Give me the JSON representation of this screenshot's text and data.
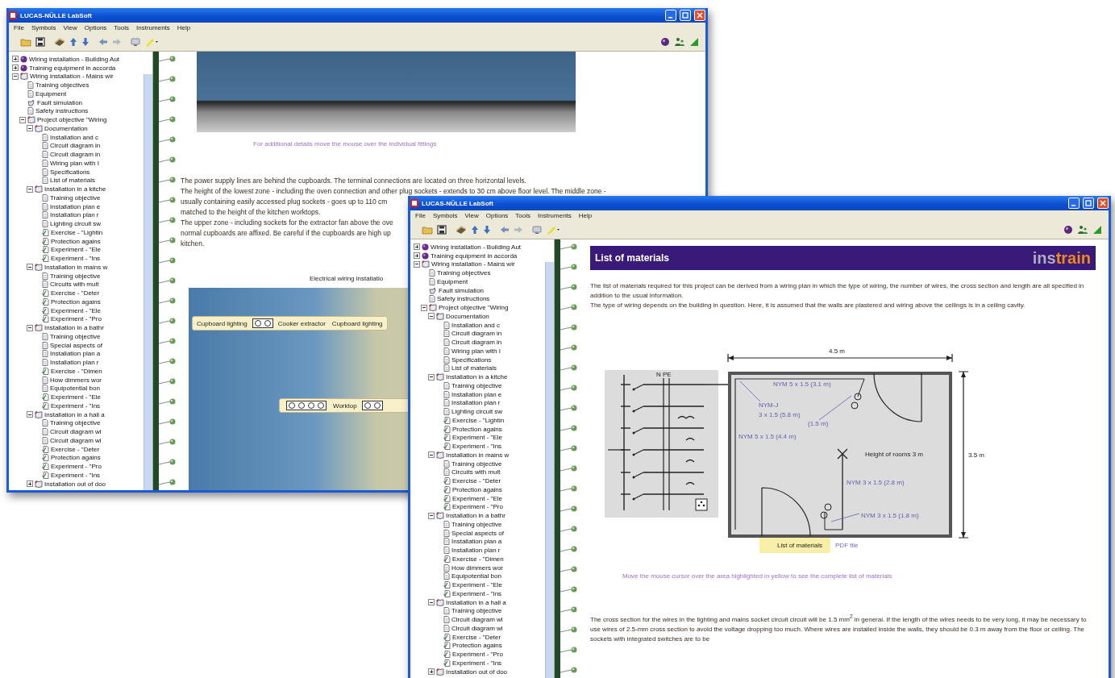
{
  "windows": [
    {
      "title": "LUCAS-NÜLLE LabSoft",
      "menu": [
        "File",
        "Symbols",
        "View",
        "Options",
        "Tools",
        "Instruments",
        "Help"
      ],
      "tree": [
        {
          "label": "Wiring installation - Building Aut",
          "kind": "module",
          "expanded": false
        },
        {
          "label": "Training equipment in accorda",
          "kind": "module",
          "expanded": false
        },
        {
          "label": "Wiring installation - Mains wir",
          "kind": "chapter",
          "expanded": true,
          "children": [
            {
              "label": "Training objectives",
              "kind": "page"
            },
            {
              "label": "Equipment",
              "kind": "page"
            },
            {
              "label": "Fault simulation",
              "kind": "tool"
            },
            {
              "label": "Safety instructions",
              "kind": "page"
            },
            {
              "label": "Project objective \"Wiring",
              "kind": "chapter",
              "expanded": true,
              "children": [
                {
                  "label": "Documentation",
                  "kind": "chapter",
                  "expanded": true,
                  "children": [
                    {
                      "label": "Installation and c",
                      "kind": "page"
                    },
                    {
                      "label": "Circuit diagram in",
                      "kind": "page"
                    },
                    {
                      "label": "Circuit diagram in",
                      "kind": "page"
                    },
                    {
                      "label": "Wiring plan with I",
                      "kind": "page"
                    },
                    {
                      "label": "Specifications",
                      "kind": "page"
                    },
                    {
                      "label": "List of materials",
                      "kind": "page"
                    }
                  ]
                },
                {
                  "label": "Installation in a kitche",
                  "kind": "chapter",
                  "expanded": true,
                  "children": [
                    {
                      "label": "Training objective",
                      "kind": "page"
                    },
                    {
                      "label": "Installation plan e",
                      "kind": "page"
                    },
                    {
                      "label": "Installation plan r",
                      "kind": "page"
                    },
                    {
                      "label": "Lighting circuit sw",
                      "kind": "page"
                    },
                    {
                      "label": "Exercise - \"Lightin",
                      "kind": "task"
                    },
                    {
                      "label": "Protection agains",
                      "kind": "task"
                    },
                    {
                      "label": "Experiment - \"Ele",
                      "kind": "task"
                    },
                    {
                      "label": "Experiment - \"Ins",
                      "kind": "task"
                    }
                  ]
                },
                {
                  "label": "Installation in mains w",
                  "kind": "chapter",
                  "expanded": true,
                  "children": [
                    {
                      "label": "Training objective",
                      "kind": "page"
                    },
                    {
                      "label": "Circuits with mult",
                      "kind": "page"
                    },
                    {
                      "label": "Exercise - \"Deter",
                      "kind": "task"
                    },
                    {
                      "label": "Protection agains",
                      "kind": "task"
                    },
                    {
                      "label": "Experiment - \"Ele",
                      "kind": "task"
                    },
                    {
                      "label": "Experiment - \"Pro",
                      "kind": "task"
                    }
                  ]
                },
                {
                  "label": "Installation in a bathr",
                  "kind": "chapter",
                  "expanded": true,
                  "children": [
                    {
                      "label": "Training objective",
                      "kind": "page"
                    },
                    {
                      "label": "Special aspects of",
                      "kind": "page"
                    },
                    {
                      "label": "Installation plan a",
                      "kind": "page"
                    },
                    {
                      "label": "Installation plan r",
                      "kind": "page"
                    },
                    {
                      "label": "Exercise - \"Dimen",
                      "kind": "task"
                    },
                    {
                      "label": "How dimmers wor",
                      "kind": "page"
                    },
                    {
                      "label": "Equipotential bon",
                      "kind": "page"
                    },
                    {
                      "label": "Experiment - \"Ele",
                      "kind": "task"
                    },
                    {
                      "label": "Experiment - \"Ins",
                      "kind": "task"
                    }
                  ]
                },
                {
                  "label": "Installation in a hall a",
                  "kind": "chapter",
                  "expanded": true,
                  "children": [
                    {
                      "label": "Training objective",
                      "kind": "page"
                    },
                    {
                      "label": "Circuit diagram wi",
                      "kind": "page"
                    },
                    {
                      "label": "Circuit diagram wi",
                      "kind": "page"
                    },
                    {
                      "label": "Exercise - \"Deter",
                      "kind": "task"
                    },
                    {
                      "label": "Protection agains",
                      "kind": "task"
                    },
                    {
                      "label": "Experiment - \"Pro",
                      "kind": "task"
                    },
                    {
                      "label": "Experiment - \"Ins",
                      "kind": "task"
                    }
                  ]
                },
                {
                  "label": "Installation out of doo",
                  "kind": "chapter",
                  "expanded": false
                }
              ]
            }
          ]
        }
      ],
      "content": {
        "kind": "kitchen",
        "caption": "For additional details move the mouse over the individual fittings",
        "lines": [
          "The power supply lines are behind the cupboards. The terminal connections are located on three horizontal levels.",
          "The height of the lowest zone - including the oven connection and other plug sockets - extends to 30 cm above floor level. The middle zone -",
          "usually containing easily accessed plug sockets - goes up to 110 cm",
          "matched to the height of the kitchen worktops.",
          "The upper zone - including sockets for the extractor fan above the ove",
          "normal cupboards are affixed. Be careful if the cupboards are high up",
          "kitchen."
        ],
        "heading": "Electrical wiring installatio",
        "hotspots_top": [
          "Cupboard lighting",
          "Cooker extractor",
          "Cupboard lighting"
        ],
        "hotspot_worktop": "Worktop"
      }
    },
    {
      "title": "LUCAS-NÜLLE LabSoft",
      "menu": [
        "File",
        "Symbols",
        "View",
        "Options",
        "Tools",
        "Instruments",
        "Help"
      ],
      "tree": [
        {
          "label": "Wiring installation - Building Aut",
          "kind": "module",
          "expanded": false
        },
        {
          "label": "Training equipment in accorda",
          "kind": "module",
          "expanded": false
        },
        {
          "label": "Wiring installation - Mains wir",
          "kind": "chapter",
          "expanded": true,
          "children": [
            {
              "label": "Training objectives",
              "kind": "page"
            },
            {
              "label": "Equipment",
              "kind": "page"
            },
            {
              "label": "Fault simulation",
              "kind": "tool"
            },
            {
              "label": "Safety instructions",
              "kind": "page"
            },
            {
              "label": "Project objective \"Wiring",
              "kind": "chapter",
              "expanded": true,
              "children": [
                {
                  "label": "Documentation",
                  "kind": "chapter",
                  "expanded": true,
                  "children": [
                    {
                      "label": "Installation and c",
                      "kind": "page"
                    },
                    {
                      "label": "Circuit diagram in",
                      "kind": "page"
                    },
                    {
                      "label": "Circuit diagram in",
                      "kind": "page"
                    },
                    {
                      "label": "Wiring plan with I",
                      "kind": "page"
                    },
                    {
                      "label": "Specifications",
                      "kind": "page"
                    },
                    {
                      "label": "List of materials",
                      "kind": "page"
                    }
                  ]
                },
                {
                  "label": "Installation in a kitche",
                  "kind": "chapter",
                  "expanded": true,
                  "children": [
                    {
                      "label": "Training objective",
                      "kind": "page"
                    },
                    {
                      "label": "Installation plan e",
                      "kind": "page"
                    },
                    {
                      "label": "Installation plan r",
                      "kind": "page"
                    },
                    {
                      "label": "Lighting circuit sw",
                      "kind": "page"
                    },
                    {
                      "label": "Exercise - \"Lightin",
                      "kind": "task"
                    },
                    {
                      "label": "Protection agains",
                      "kind": "task"
                    },
                    {
                      "label": "Experiment - \"Ele",
                      "kind": "task"
                    },
                    {
                      "label": "Experiment - \"Ins",
                      "kind": "task"
                    }
                  ]
                },
                {
                  "label": "Installation in mains w",
                  "kind": "chapter",
                  "expanded": true,
                  "children": [
                    {
                      "label": "Training objective",
                      "kind": "page"
                    },
                    {
                      "label": "Circuits with mult",
                      "kind": "page"
                    },
                    {
                      "label": "Exercise - \"Deter",
                      "kind": "task"
                    },
                    {
                      "label": "Protection agains",
                      "kind": "task"
                    },
                    {
                      "label": "Experiment - \"Ele",
                      "kind": "task"
                    },
                    {
                      "label": "Experiment - \"Pro",
                      "kind": "task"
                    }
                  ]
                },
                {
                  "label": "Installation in a bathr",
                  "kind": "chapter",
                  "expanded": true,
                  "children": [
                    {
                      "label": "Training objective",
                      "kind": "page"
                    },
                    {
                      "label": "Special aspects of",
                      "kind": "page"
                    },
                    {
                      "label": "Installation plan a",
                      "kind": "page"
                    },
                    {
                      "label": "Installation plan r",
                      "kind": "page"
                    },
                    {
                      "label": "Exercise - \"Dimen",
                      "kind": "task"
                    },
                    {
                      "label": "How dimmers wor",
                      "kind": "page"
                    },
                    {
                      "label": "Equipotential bon",
                      "kind": "page"
                    },
                    {
                      "label": "Experiment - \"Ele",
                      "kind": "task"
                    },
                    {
                      "label": "Experiment - \"Ins",
                      "kind": "task"
                    }
                  ]
                },
                {
                  "label": "Installation in a hall a",
                  "kind": "chapter",
                  "expanded": true,
                  "children": [
                    {
                      "label": "Training objective",
                      "kind": "page"
                    },
                    {
                      "label": "Circuit diagram wi",
                      "kind": "page"
                    },
                    {
                      "label": "Circuit diagram wi",
                      "kind": "page"
                    },
                    {
                      "label": "Exercise - \"Deter",
                      "kind": "task"
                    },
                    {
                      "label": "Protection agains",
                      "kind": "task"
                    },
                    {
                      "label": "Experiment - \"Pro",
                      "kind": "task"
                    },
                    {
                      "label": "Experiment - \"Ins",
                      "kind": "task"
                    }
                  ]
                },
                {
                  "label": "Installation out of doo",
                  "kind": "chapter",
                  "expanded": false
                }
              ]
            }
          ]
        }
      ],
      "content": {
        "kind": "materials",
        "header": "List of materials",
        "logo": "instrain",
        "paragraphs": [
          "The list of materials required for this project can be derived from a wiring plan in which the type of wiring, the number of wires, the cross section and length are all specified in addition to the usual information.",
          "The type of wiring depends on the building in question. Here, it is assumed that the walls are plastered and wiring above the ceilings is in a ceiling cavity."
        ],
        "plan": {
          "width_label": "4.5 m",
          "height_label": "3.5 m",
          "room_note": "Height of rooms 3 m",
          "bus_label": "N PE",
          "cable_labels": [
            "NYM 5 x 1.5 (3.1 m)",
            "NYM-J",
            "3 x 1.5 (5.8 m)",
            "(1.5 m)",
            "NYM 5 x 1.5 (4.4 m)",
            "NYM 3 x 1.5 (2.8 m)",
            "NYM 3 x 1.5 (1.8 m)"
          ]
        },
        "button": "List of materials",
        "link": "PDF file",
        "caption": "Move the mouse cursor over the area highlighted in yellow to see the complete list of materials",
        "bottom": "The cross section for the wires in the lighting and mains socket circuit circuit will be 1.5 mm$^{2}$ in general. If the length of the wires needs to be very long, it may be necessary to use wires of 2.5-mm cross section to avoid the voltage dropping too much. Where wires are installed inside the walls, they should be 0.3 m away from the floor or ceiling. The sockets with integrated switches are to be"
      }
    }
  ]
}
